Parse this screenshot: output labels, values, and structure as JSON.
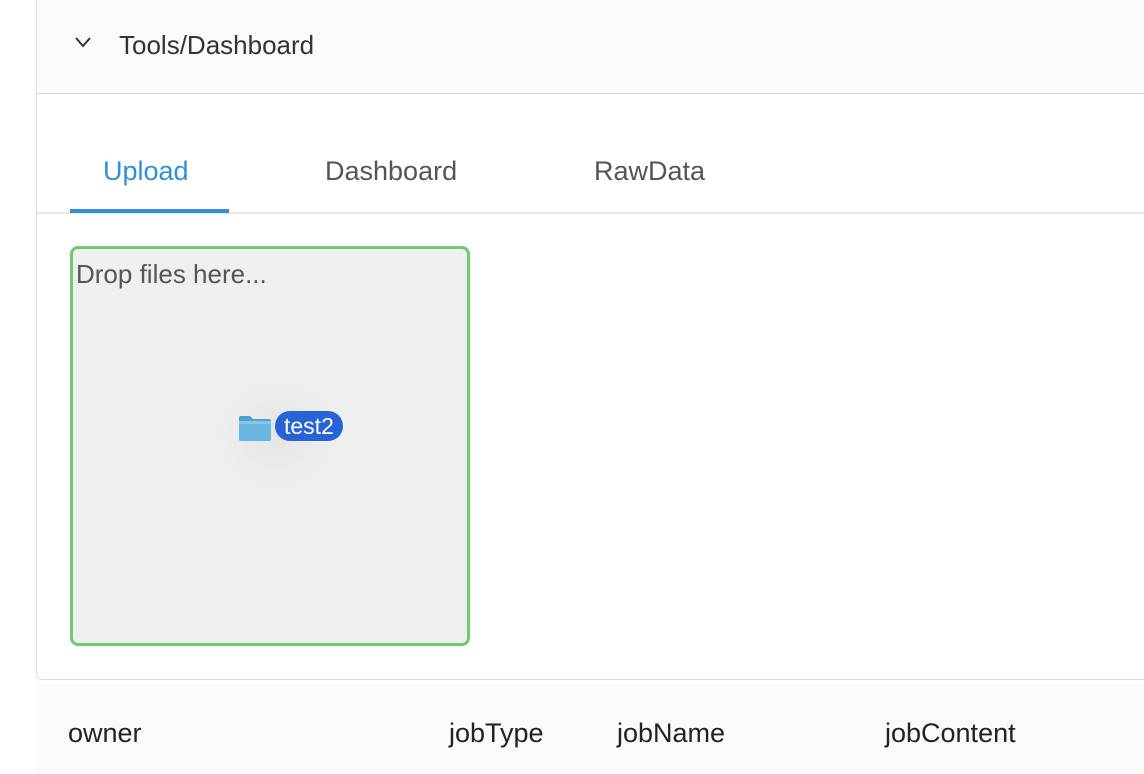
{
  "panel": {
    "title": "Tools/Dashboard"
  },
  "tabs": [
    {
      "label": "Upload",
      "active": true
    },
    {
      "label": "Dashboard",
      "active": false
    },
    {
      "label": "RawData",
      "active": false
    }
  ],
  "dropzone": {
    "hint": "Drop files here...",
    "dragged_item": {
      "name": "test2",
      "icon": "folder-icon"
    }
  },
  "table": {
    "columns": [
      "owner",
      "jobType",
      "jobName",
      "jobContent"
    ]
  },
  "colors": {
    "accent": "#2f8fdb",
    "dropzone_border": "#6fcb6f",
    "selection": "#2763d6"
  }
}
